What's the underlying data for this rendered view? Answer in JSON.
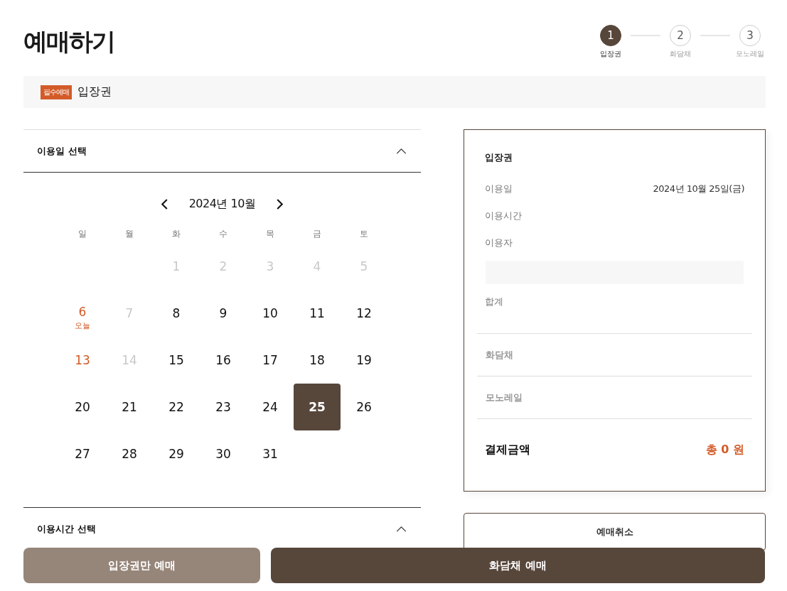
{
  "page_title": "예매하기",
  "steps": [
    {
      "number": "1",
      "label": "입장권",
      "selected": true
    },
    {
      "number": "2",
      "label": "화담채",
      "selected": false
    },
    {
      "number": "3",
      "label": "모노레일",
      "selected": false
    }
  ],
  "section": {
    "badge": "필수예매",
    "title": "입장권"
  },
  "date_section": {
    "title": "이용일 선택",
    "expanded": true
  },
  "calendar": {
    "month_label": "2024년 10월",
    "weekdays": [
      "일",
      "월",
      "화",
      "수",
      "목",
      "금",
      "토"
    ],
    "weeks": [
      [
        {
          "kind": "blank"
        },
        {
          "kind": "blank"
        },
        {
          "label": "1",
          "kind": "disabled",
          "selected": false
        },
        {
          "label": "2",
          "kind": "disabled",
          "selected": false
        },
        {
          "label": "3",
          "kind": "disabled",
          "selected": false
        },
        {
          "label": "4",
          "kind": "disabled",
          "selected": false
        },
        {
          "label": "5",
          "kind": "disabled",
          "selected": false
        }
      ],
      [
        {
          "label": "6",
          "kind": "today",
          "note": "오늘",
          "selected": false
        },
        {
          "label": "7",
          "kind": "disabled",
          "selected": false
        },
        {
          "label": "8",
          "kind": "normal",
          "selected": false
        },
        {
          "label": "9",
          "kind": "normal",
          "selected": false
        },
        {
          "label": "10",
          "kind": "normal",
          "selected": false
        },
        {
          "label": "11",
          "kind": "normal",
          "selected": false
        },
        {
          "label": "12",
          "kind": "normal",
          "selected": false
        }
      ],
      [
        {
          "label": "13",
          "kind": "holiday",
          "selected": false
        },
        {
          "label": "14",
          "kind": "disabled",
          "selected": false
        },
        {
          "label": "15",
          "kind": "normal",
          "selected": false
        },
        {
          "label": "16",
          "kind": "normal",
          "selected": false
        },
        {
          "label": "17",
          "kind": "normal",
          "selected": false
        },
        {
          "label": "18",
          "kind": "normal",
          "selected": false
        },
        {
          "label": "19",
          "kind": "normal",
          "selected": false
        }
      ],
      [
        {
          "label": "20",
          "kind": "normal",
          "selected": false
        },
        {
          "label": "21",
          "kind": "normal",
          "selected": false
        },
        {
          "label": "22",
          "kind": "normal",
          "selected": false
        },
        {
          "label": "23",
          "kind": "normal",
          "selected": false
        },
        {
          "label": "24",
          "kind": "normal",
          "selected": false
        },
        {
          "label": "25",
          "kind": "normal",
          "selected": true
        },
        {
          "label": "26",
          "kind": "normal",
          "selected": false
        }
      ],
      [
        {
          "label": "27",
          "kind": "normal",
          "selected": false
        },
        {
          "label": "28",
          "kind": "normal",
          "selected": false
        },
        {
          "label": "29",
          "kind": "normal",
          "selected": false
        },
        {
          "label": "30",
          "kind": "normal",
          "selected": false
        },
        {
          "label": "31",
          "kind": "normal",
          "selected": false
        },
        {
          "kind": "blank"
        },
        {
          "kind": "blank"
        }
      ]
    ]
  },
  "time_section": {
    "title": "이용시간 선택",
    "expanded": true
  },
  "summary": {
    "title": "입장권",
    "rows": [
      {
        "label": "이용일",
        "value": "2024년 10월 25일(금)"
      },
      {
        "label": "이용시간"
      },
      {
        "label": "이용자"
      }
    ],
    "total_label": "합계",
    "extras": [
      "화담채",
      "모노레일"
    ],
    "payment_label": "결제금액",
    "payment_value": "총 0 원"
  },
  "cancel_button": "예매취소",
  "bottom_buttons": [
    {
      "label": "입장권만 예매",
      "kind": "secondary"
    },
    {
      "label": "화담채 예매",
      "kind": "primary"
    }
  ]
}
